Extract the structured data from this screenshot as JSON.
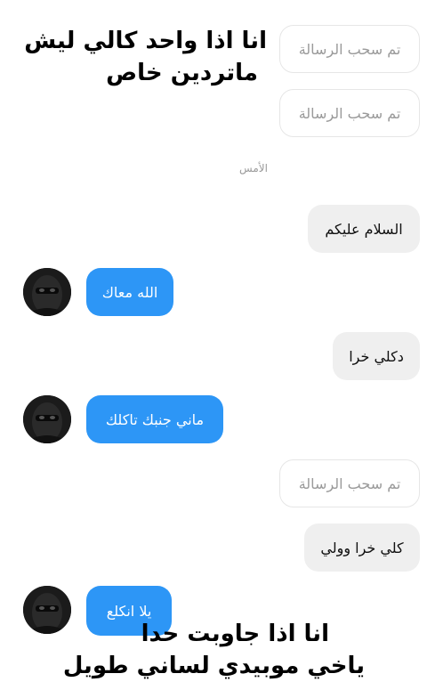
{
  "overlay_top": {
    "line1": "انا اذا واحد كالي ليش",
    "line2": "ماتردين خاص"
  },
  "overlay_bottom": {
    "line1": "انا اذا جاوبت حدا",
    "line2": "ياخي موبيدي لساني طويل"
  },
  "day_separator": "الأمس",
  "messages": [
    {
      "text": "تم سحب الرسالة",
      "kind": "unsent"
    },
    {
      "text": "تم سحب الرسالة",
      "kind": "unsent"
    },
    {
      "text": "السلام عليكم",
      "kind": "incoming"
    },
    {
      "text": "الله معاك",
      "kind": "outgoing"
    },
    {
      "text": "دكلي خرا",
      "kind": "incoming"
    },
    {
      "text": "ماني جنبك تاكلك",
      "kind": "outgoing"
    },
    {
      "text": "تم سحب الرسالة",
      "kind": "unsent"
    },
    {
      "text": "كلي خرا وولي",
      "kind": "incoming"
    },
    {
      "text": "يلا انكلع",
      "kind": "outgoing"
    }
  ],
  "colors": {
    "outgoing_bubble": "#2d96f6",
    "incoming_bubble": "#efefef",
    "unsent_border": "#e6e6e6"
  }
}
